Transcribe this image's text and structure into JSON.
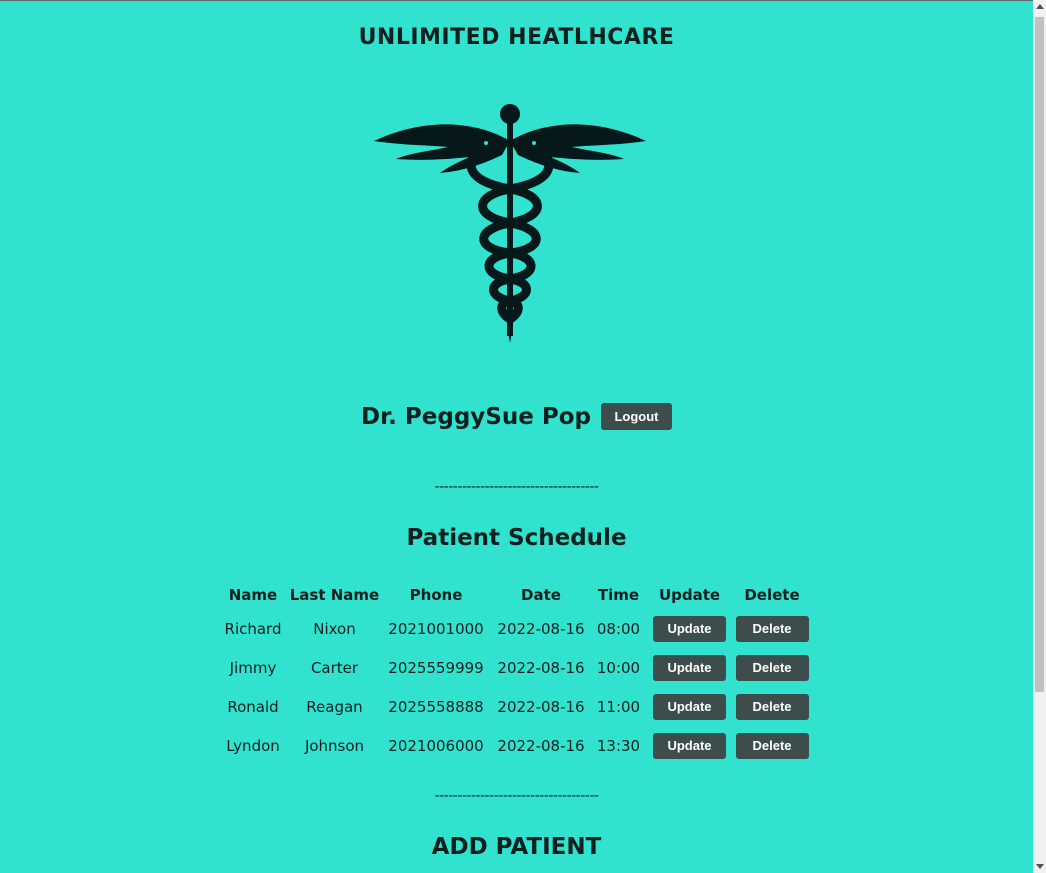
{
  "header": {
    "title": "UNLIMITED HEATLHCARE"
  },
  "logo": {
    "icon": "caduceus-icon",
    "color": "#06181a"
  },
  "user": {
    "name": "Dr. PeggySue Pop",
    "logout_label": "Logout"
  },
  "divider": "------------------------------------",
  "schedule": {
    "title": "Patient Schedule",
    "columns": [
      "Name",
      "Last Name",
      "Phone",
      "Date",
      "Time",
      "Update",
      "Delete"
    ],
    "rows": [
      {
        "name": "Richard",
        "last_name": "Nixon",
        "phone": "2021001000",
        "date": "2022-08-16",
        "time": "08:00",
        "update": "Update",
        "delete": "Delete"
      },
      {
        "name": "Jimmy",
        "last_name": "Carter",
        "phone": "2025559999",
        "date": "2022-08-16",
        "time": "10:00",
        "update": "Update",
        "delete": "Delete"
      },
      {
        "name": "Ronald",
        "last_name": "Reagan",
        "phone": "2025558888",
        "date": "2022-08-16",
        "time": "11:00",
        "update": "Update",
        "delete": "Delete"
      },
      {
        "name": "Lyndon",
        "last_name": "Johnson",
        "phone": "2021006000",
        "date": "2022-08-16",
        "time": "13:30",
        "update": "Update",
        "delete": "Delete"
      }
    ]
  },
  "add_patient": {
    "title": "ADD PATIENT"
  },
  "colors": {
    "background": "#31e3cf",
    "button": "#3d4d4c",
    "text": "#0d1f1f"
  }
}
